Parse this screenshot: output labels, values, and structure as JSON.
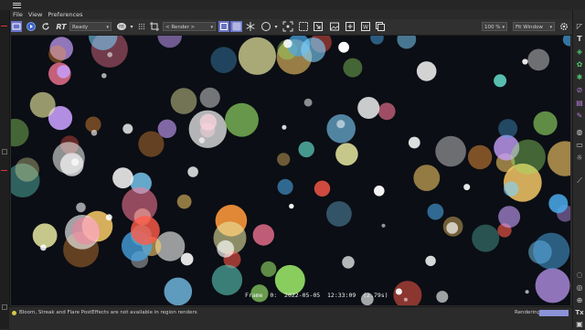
{
  "menu": {
    "file": "File",
    "view": "View",
    "preferences": "Preferences"
  },
  "toolbar": {
    "rt_label": "RT",
    "state_value": "Ready",
    "camera_value": "< Render >",
    "zoom_value": "100 %",
    "fit_value": "Fit Window"
  },
  "viewport": {
    "frame_info": "Frame  0:  2022-05-05  12:33:09  (2.79s)"
  },
  "status": {
    "message": "Bloom, Streak and Flare PostEffects are not available in region renders",
    "rendering_label": "Rendering",
    "progress": 1.0
  },
  "colors": {
    "accent": "#6a72c8",
    "progress": "#8b93d8",
    "warning": "#d5c74a"
  },
  "icons": [
    "hamburger-icon",
    "refresh-icon",
    "rt-icon",
    "settings-icon",
    "crop-icon",
    "grid-icon",
    "snowflake-icon",
    "circle-icon",
    "region-icon",
    "image-icon",
    "compare-icon",
    "channel-icon",
    "gear-icon"
  ]
}
